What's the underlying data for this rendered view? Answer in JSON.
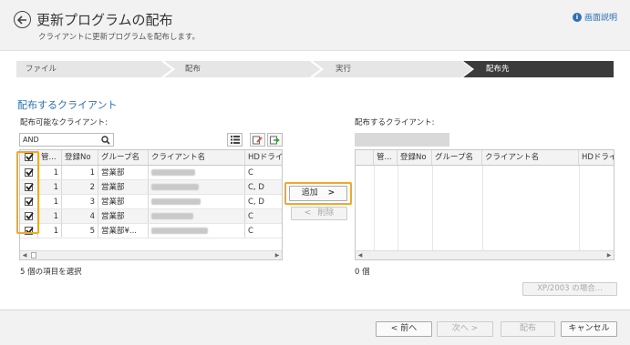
{
  "header": {
    "title": "更新プログラムの配布",
    "subtitle": "クライアントに更新プログラムを配布します。",
    "help": "画面説明"
  },
  "steps": [
    "ファイル",
    "配布",
    "実行",
    "配布先"
  ],
  "section_title": "配布するクライアント",
  "available": {
    "label": "配布可能なクライアント:",
    "search_value": "AND",
    "columns": [
      "管...",
      "登録No",
      "グループ名",
      "クライアント名",
      "HDドライ"
    ],
    "rows": [
      {
        "checked": true,
        "kan": "1",
        "no": "1",
        "group": "営業部",
        "drive": "C"
      },
      {
        "checked": true,
        "kan": "1",
        "no": "2",
        "group": "営業部",
        "drive": "C, D"
      },
      {
        "checked": true,
        "kan": "1",
        "no": "3",
        "group": "営業部",
        "drive": "C, D"
      },
      {
        "checked": true,
        "kan": "1",
        "no": "4",
        "group": "営業部",
        "drive": "C"
      },
      {
        "checked": true,
        "kan": "1",
        "no": "5",
        "group": "営業部¥...",
        "drive": "C"
      }
    ],
    "selected_count": "5 個の項目を選択"
  },
  "destination": {
    "label": "配布するクライアント:",
    "columns": [
      "管...",
      "登録No",
      "グループ名",
      "クライアント名",
      "HDドライ"
    ],
    "count": "0 個",
    "xp_button": "XP/2003 の場合..."
  },
  "middle": {
    "add": "追加",
    "remove": "削除"
  },
  "footer": {
    "back": "< 前へ",
    "next": "次へ >",
    "deploy": "配布",
    "cancel": "キャンセル"
  }
}
